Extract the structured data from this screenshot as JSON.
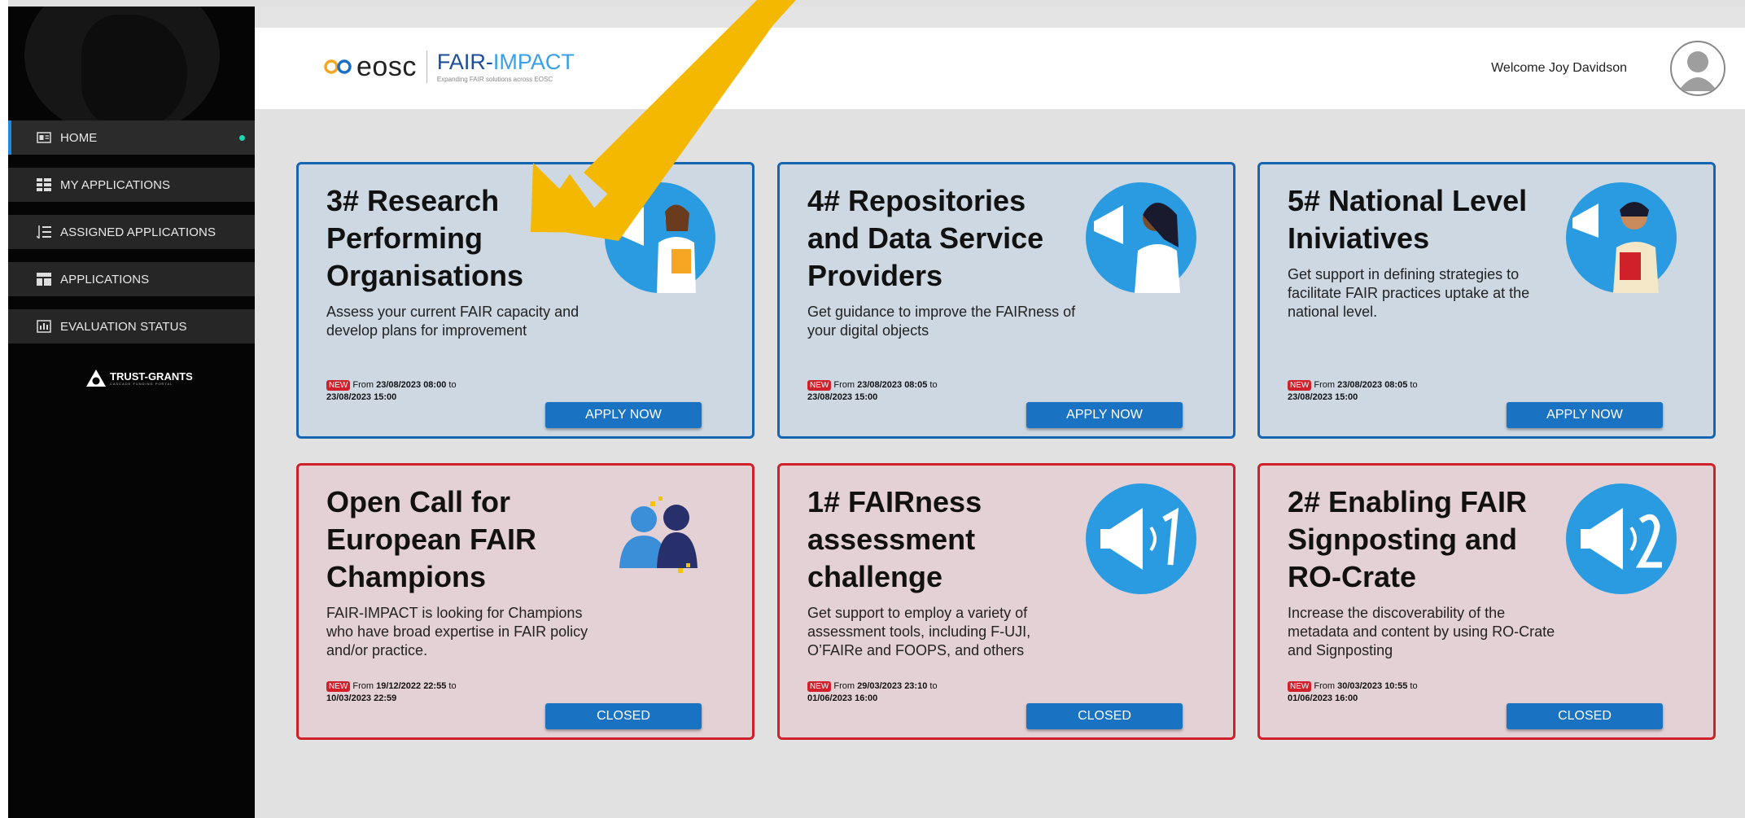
{
  "sidebar": {
    "items": [
      {
        "label": "HOME",
        "icon": "home-icon"
      },
      {
        "label": "MY APPLICATIONS",
        "icon": "list-icon"
      },
      {
        "label": "ASSIGNED APPLICATIONS",
        "icon": "assigned-list-icon"
      },
      {
        "label": "APPLICATIONS",
        "icon": "grid-icon"
      },
      {
        "label": "EVALUATION STATUS",
        "icon": "chart-icon"
      }
    ],
    "logo_text": "TRUST-GRANTS",
    "logo_sub": "CASCADE FUNDING PORTAL"
  },
  "header": {
    "eosc": "eosc",
    "fair_prefix": "FAIR-",
    "fair_highlight": "IMPACT",
    "fair_sub": "Expanding FAIR solutions across EOSC",
    "welcome": "Welcome Joy Davidson"
  },
  "cards": [
    {
      "title": "3# Research Performing Organisations",
      "desc": "Assess your current FAIR capacity and develop plans for improvement",
      "badge": "NEW",
      "from_label": "From",
      "start": "23/08/2023 08:00",
      "to_label": "to",
      "end": "23/08/2023 15:00",
      "button": "APPLY NOW"
    },
    {
      "title": "4# Repositories and Data Service Providers",
      "desc": "Get guidance to improve the FAIRness of your digital objects",
      "badge": "NEW",
      "from_label": "From",
      "start": "23/08/2023 08:05",
      "to_label": "to",
      "end": "23/08/2023 15:00",
      "button": "APPLY NOW"
    },
    {
      "title": "5# National Level Iniviatives",
      "desc": "Get support in defining strategies to facilitate FAIR practices uptake at the national level.",
      "badge": "NEW",
      "from_label": "From",
      "start": "23/08/2023 08:05",
      "to_label": "to",
      "end": "23/08/2023 15:00",
      "button": "APPLY NOW"
    },
    {
      "title": "Open Call for European FAIR Champions",
      "desc": "FAIR-IMPACT is looking for Champions who have broad expertise in FAIR policy and/or practice.",
      "badge": "NEW",
      "from_label": "From",
      "start": "19/12/2022 22:55",
      "to_label": "to",
      "end": "10/03/2023 22:59",
      "button": "CLOSED"
    },
    {
      "title": "1# FAIRness assessment challenge",
      "desc": "Get support to employ a variety of assessment tools, including F-UJI, O’FAIRe and FOOPS, and others",
      "badge": "NEW",
      "from_label": "From",
      "start": "29/03/2023 23:10",
      "to_label": "to",
      "end": "01/06/2023 16:00",
      "button": "CLOSED"
    },
    {
      "title": "2# Enabling FAIR Signposting and RO-Crate",
      "desc": "Increase the discoverability of the metadata and content by using RO-Crate and Signposting",
      "badge": "NEW",
      "from_label": "From",
      "start": "30/03/2023 10:55",
      "to_label": "to",
      "end": "01/06/2023 16:00",
      "button": "CLOSED"
    }
  ],
  "colors": {
    "open_border": "#1565b3",
    "closed_border": "#d0202a",
    "button": "#1a73c2",
    "arrow": "#f5b800",
    "active_dot": "#1ed5b0"
  }
}
